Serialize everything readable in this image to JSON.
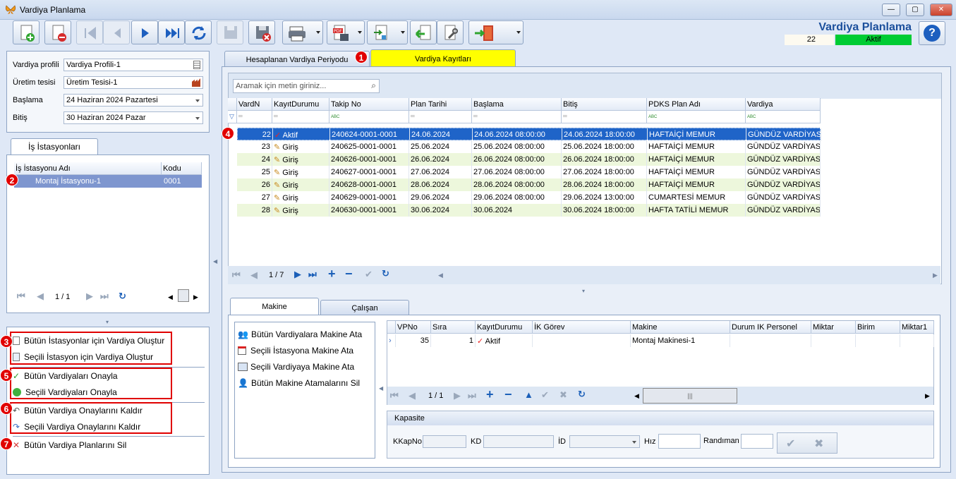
{
  "window": {
    "title": "Vardiya Planlama",
    "minimize": "—",
    "maximize": "▢",
    "close": "✕"
  },
  "header": {
    "title": "Vardiya Planlama",
    "count": "22",
    "status": "Aktif",
    "help": "?"
  },
  "colors": {
    "accent": "#1b4f9c",
    "active_tab": "#ffff00",
    "status_green": "#00cc33",
    "selected_row": "#1f64c8",
    "badge_red": "#e10000"
  },
  "left": {
    "profile_label": "Vardiya profili",
    "profile_value": "Vardiya Profili-1",
    "plant_label": "Üretim tesisi",
    "plant_value": "Üretim Tesisi-1",
    "start_label": "Başlama",
    "start_value": "24 Haziran 2024 Pazartesi",
    "end_label": "Bitiş",
    "end_value": "30 Haziran 2024 Pazar",
    "stations_tab": "İş İstasyonları",
    "stations_cols": [
      "İş İstasyonu Adı",
      "Kodu"
    ],
    "station_name": "Montaj İstasyonu-1",
    "station_code": "0001",
    "page": "1 / 1"
  },
  "actions": {
    "a1": "Bütün İstasyonlar için Vardiya Oluştur",
    "a2": "Seçili İstasyon için Vardiya Oluştur",
    "a3": "Bütün Vardiyaları Onayla",
    "a4": "Seçili Vardiyaları Onayla",
    "a5": "Bütün Vardiya Onaylarını Kaldır",
    "a6": "Seçili Vardiya Onaylarını Kaldır",
    "a7": "Bütün Vardiya Planlarını Sil"
  },
  "badges": [
    "1",
    "2",
    "3",
    "4",
    "5",
    "6",
    "7"
  ],
  "main": {
    "tab1": "Hesaplanan Vardiya Periyodu",
    "tab2": "Vardiya Kayıtları",
    "search_placeholder": "Aramak için metin giriniz...",
    "cols": [
      "VardN",
      "KayıtDurumu",
      "Takip No",
      "Plan Tarihi",
      "Başlama",
      "Bitiş",
      "PDKS Plan Adı",
      "Vardiya"
    ],
    "rows": [
      [
        "22",
        "Aktif",
        "240624-0001-0001",
        "24.06.2024",
        "24.06.2024 08:00:00",
        "24.06.2024 18:00:00",
        "HAFTAİÇİ MEMUR",
        "GÜNDÜZ VARDİYASI"
      ],
      [
        "23",
        "Giriş",
        "240625-0001-0001",
        "25.06.2024",
        "25.06.2024 08:00:00",
        "25.06.2024 18:00:00",
        "HAFTAİÇİ MEMUR",
        "GÜNDÜZ VARDİYASI"
      ],
      [
        "24",
        "Giriş",
        "240626-0001-0001",
        "26.06.2024",
        "26.06.2024 08:00:00",
        "26.06.2024 18:00:00",
        "HAFTAİÇİ MEMUR",
        "GÜNDÜZ VARDİYASI"
      ],
      [
        "25",
        "Giriş",
        "240627-0001-0001",
        "27.06.2024",
        "27.06.2024 08:00:00",
        "27.06.2024 18:00:00",
        "HAFTAİÇİ MEMUR",
        "GÜNDÜZ VARDİYASI"
      ],
      [
        "26",
        "Giriş",
        "240628-0001-0001",
        "28.06.2024",
        "28.06.2024 08:00:00",
        "28.06.2024 18:00:00",
        "HAFTAİÇİ MEMUR",
        "GÜNDÜZ VARDİYASI"
      ],
      [
        "27",
        "Giriş",
        "240629-0001-0001",
        "29.06.2024",
        "29.06.2024 08:00:00",
        "29.06.2024 13:00:00",
        "CUMARTESİ MEMUR",
        "GÜNDÜZ VARDİYASI"
      ],
      [
        "28",
        "Giriş",
        "240630-0001-0001",
        "30.06.2024",
        "30.06.2024",
        "30.06.2024 18:00:00",
        "HAFTA TATİLİ MEMUR",
        "GÜNDÜZ VARDİYASI"
      ]
    ],
    "filter_text": "ABC",
    "page": "1 / 7"
  },
  "bottom": {
    "tab1": "Makine",
    "tab2": "Çalışan",
    "menu": [
      "Bütün Vardiyalara Makine Ata",
      "Seçili İstasyona Makine Ata",
      "Seçili Vardiyaya Makine Ata",
      "Bütün Makine Atamalarını Sil"
    ],
    "cols": [
      "VPNo",
      "Sıra",
      "KayıtDurumu",
      "İK Görev",
      "Makine",
      "Durum IK Personel",
      "Miktar",
      "Birim",
      "Miktar1"
    ],
    "row": [
      "35",
      "1",
      "Aktif",
      "",
      "Montaj Makinesi-1",
      "",
      "",
      "",
      ""
    ],
    "page": "1 / 1",
    "capacity_title": "Kapasite",
    "kkapno": "KKapNo",
    "kd": "KD",
    "id": "İD",
    "hiz": "Hız",
    "randiman": "Randıman"
  }
}
